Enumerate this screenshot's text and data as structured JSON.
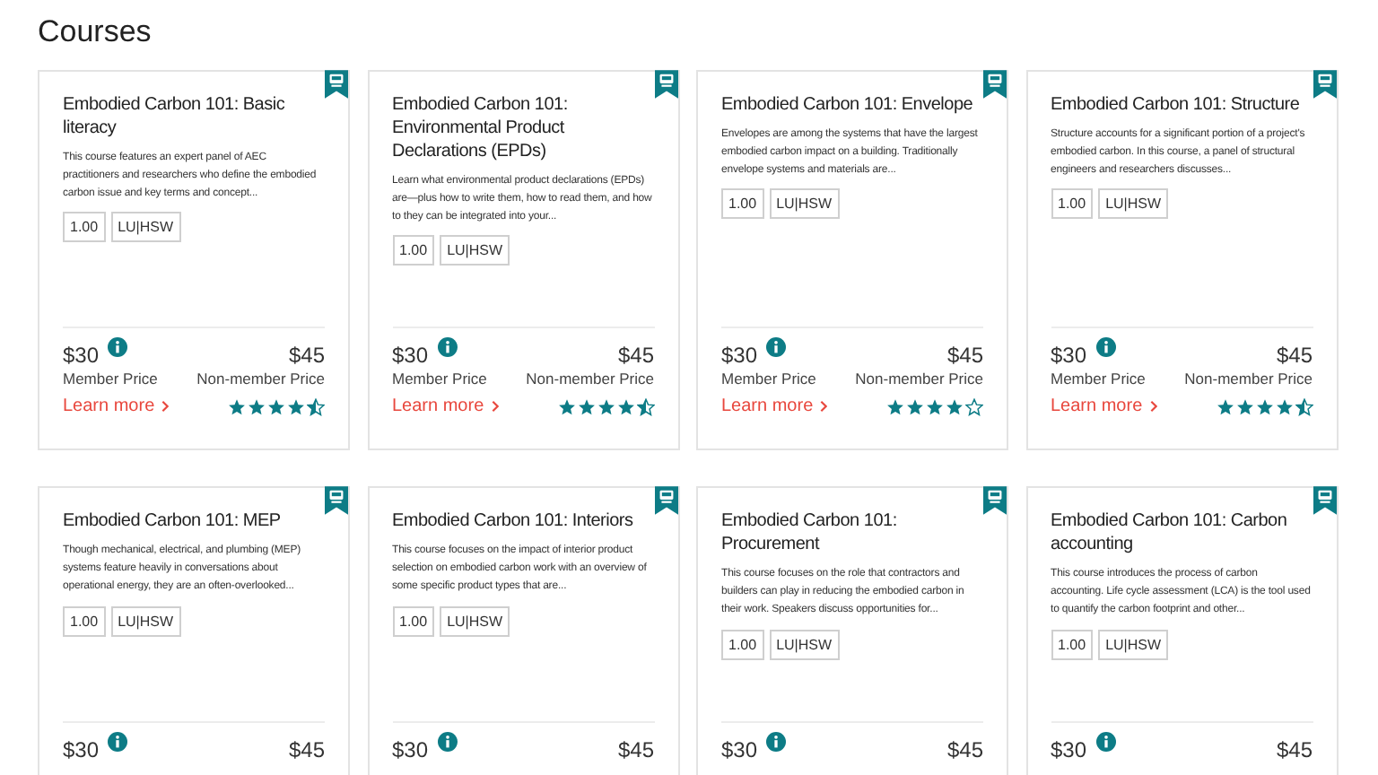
{
  "heading": "Courses",
  "courses": [
    {
      "title": "Embodied Carbon 101: Basic literacy",
      "description": "This course features an expert panel of AEC practitioners and researchers who define the embodied carbon issue and key terms and concept...",
      "tags": [
        "1.00",
        "LU|HSW"
      ],
      "member_price": "$30",
      "member_label": "Member Price",
      "nonmember_price": "$45",
      "nonmember_label": "Non-member Price",
      "link": "Learn more",
      "stars": 4.5
    },
    {
      "title": "Embodied Carbon 101: Environmental Product Declarations (EPDs)",
      "description": "Learn what environmental product declarations (EPDs) are—plus how to write them, how to read them, and how to they can be integrated into your...",
      "tags": [
        "1.00",
        "LU|HSW"
      ],
      "member_price": "$30",
      "member_label": "Member Price",
      "nonmember_price": "$45",
      "nonmember_label": "Non-member Price",
      "link": "Learn more",
      "stars": 4.5
    },
    {
      "title": "Embodied Carbon 101: Envelope",
      "description": "Envelopes are among the systems that have the largest embodied carbon impact on a building. Traditionally envelope systems and materials are...",
      "tags": [
        "1.00",
        "LU|HSW"
      ],
      "member_price": "$30",
      "member_label": "Member Price",
      "nonmember_price": "$45",
      "nonmember_label": "Non-member Price",
      "link": "Learn more",
      "stars": 4
    },
    {
      "title": "Embodied Carbon 101: Structure",
      "description": "Structure accounts for a significant portion of a project's embodied carbon. In this course, a panel of structural engineers and researchers discusses...",
      "tags": [
        "1.00",
        "LU|HSW"
      ],
      "member_price": "$30",
      "member_label": "Member Price",
      "nonmember_price": "$45",
      "nonmember_label": "Non-member Price",
      "link": "Learn more",
      "stars": 4.5
    },
    {
      "title": "Embodied Carbon 101: MEP",
      "description": "Though mechanical, electrical, and plumbing (MEP) systems feature heavily in conversations about operational energy, they are an often-overlooked...",
      "tags": [
        "1.00",
        "LU|HSW"
      ],
      "member_price": "$30",
      "nonmember_price": "$45"
    },
    {
      "title": "Embodied Carbon 101: Interiors",
      "description": "This course focuses on the impact of interior product selection on embodied carbon work with an overview of some specific product types that are...",
      "tags": [
        "1.00",
        "LU|HSW"
      ],
      "member_price": "$30",
      "nonmember_price": "$45"
    },
    {
      "title": "Embodied Carbon 101: Procurement",
      "description": "This course focuses on the role that contractors and builders can play in reducing the embodied carbon in their work. Speakers discuss opportunities for...",
      "tags": [
        "1.00",
        "LU|HSW"
      ],
      "member_price": "$30",
      "nonmember_price": "$45"
    },
    {
      "title": "Embodied Carbon 101: Carbon accounting",
      "description": "This course introduces the process of carbon accounting. Life cycle assessment (LCA) is the tool used to quantify the carbon footprint and other...",
      "tags": [
        "1.00",
        "LU|HSW"
      ],
      "member_price": "$30",
      "nonmember_price": "$45"
    }
  ]
}
